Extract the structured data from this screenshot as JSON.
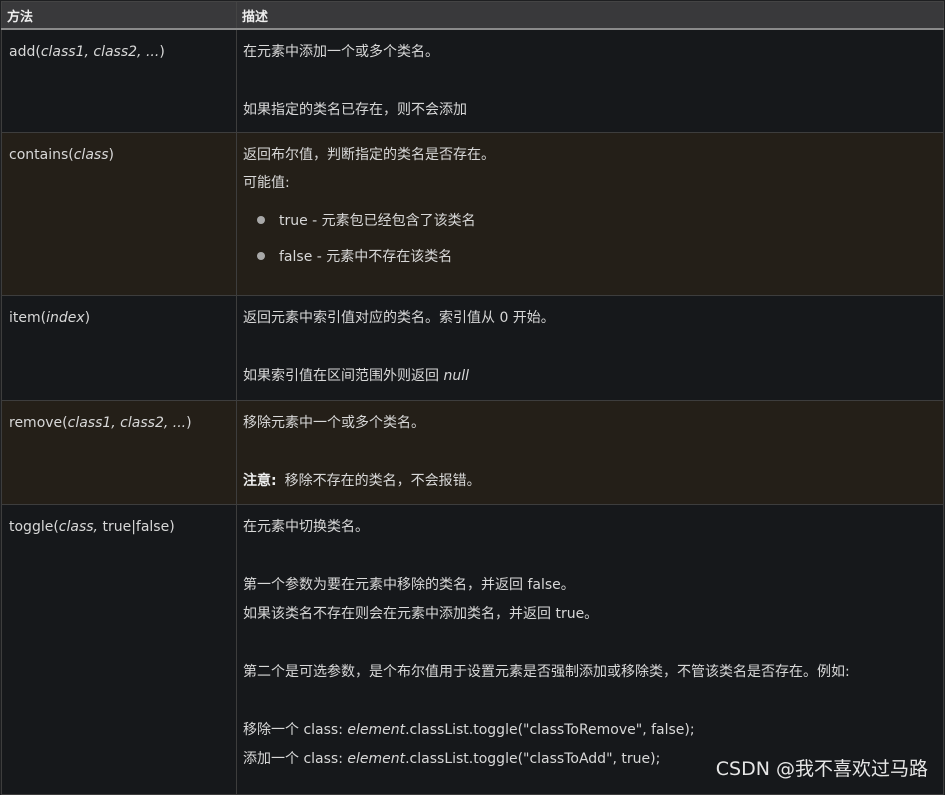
{
  "header": {
    "col_method": "方法",
    "col_desc": "描述"
  },
  "rows": {
    "add": {
      "name": "add(",
      "param": "class1, class2, ...",
      "close": ")",
      "desc_line1": "在元素中添加一个或多个类名。",
      "desc_line2": "如果指定的类名已存在，则不会添加"
    },
    "contains": {
      "name": "contains(",
      "param": "class",
      "close": ")",
      "desc_line1": "返回布尔值，判断指定的类名是否存在。",
      "desc_line2": "可能值:",
      "value_true": "true - 元素包已经包含了该类名",
      "value_false": "false - 元素中不存在该类名"
    },
    "item": {
      "name": "item(",
      "param": "index",
      "close": ")",
      "desc_line1": "返回元素中索引值对应的类名。索引值从 0 开始。",
      "desc_line2_pre": "如果索引值在区间范围外则返回 ",
      "desc_line2_em": "null"
    },
    "remove": {
      "name": "remove(",
      "param": "class1, class2, ...",
      "close": ")",
      "desc_line1": "移除元素中一个或多个类名。",
      "note_label": "注意:",
      "note_text": "移除不存在的类名，不会报错。"
    },
    "toggle": {
      "name": "toggle(",
      "param": "class,",
      "rest": " true|false)",
      "desc_line1": "在元素中切换类名。",
      "desc_line2": "第一个参数为要在元素中移除的类名，并返回 false。",
      "desc_line3": "如果该类名不存在则会在元素中添加类名，并返回 true。",
      "desc_line4": "第二个是可选参数，是个布尔值用于设置元素是否强制添加或移除类，不管该类名是否存在。例如:",
      "ex1_pre": "移除一个 class: ",
      "ex1_em": "element",
      "ex1_post": ".classList.toggle(\"classToRemove\", false);",
      "ex2_pre": "添加一个 class: ",
      "ex2_em": "element",
      "ex2_post": ".classList.toggle(\"classToAdd\", true);"
    }
  },
  "watermark": "CSDN @我不喜欢过马路"
}
